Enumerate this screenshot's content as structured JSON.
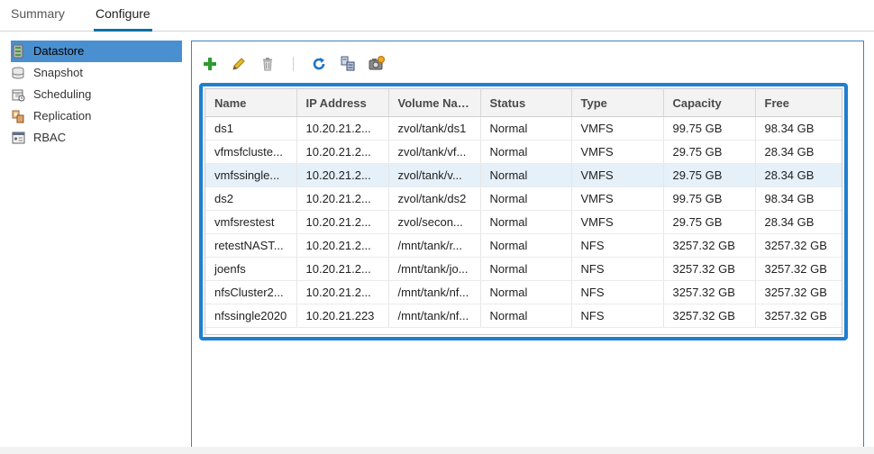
{
  "tabs": [
    {
      "label": "Summary",
      "active": false
    },
    {
      "label": "Configure",
      "active": true
    }
  ],
  "sidebar": {
    "items": [
      {
        "label": "Datastore",
        "icon": "datastore-icon",
        "active": true
      },
      {
        "label": "Snapshot",
        "icon": "snapshot-icon",
        "active": false
      },
      {
        "label": "Scheduling",
        "icon": "scheduling-icon",
        "active": false
      },
      {
        "label": "Replication",
        "icon": "replication-icon",
        "active": false
      },
      {
        "label": "RBAC",
        "icon": "rbac-icon",
        "active": false
      }
    ]
  },
  "toolbar": {
    "buttons": [
      "add-icon",
      "edit-icon",
      "delete-icon",
      "refresh-icon",
      "mount-icon",
      "snapshot-camera-icon"
    ]
  },
  "grid": {
    "columns": [
      "Name",
      "IP Address",
      "Volume Name...",
      "Status",
      "Type",
      "Capacity",
      "Free"
    ],
    "rows": [
      [
        "ds1",
        "10.20.21.2...",
        "zvol/tank/ds1",
        "Normal",
        "VMFS",
        "99.75 GB",
        "98.34 GB"
      ],
      [
        "vfmsfcluste...",
        "10.20.21.2...",
        "zvol/tank/vf...",
        "Normal",
        "VMFS",
        "29.75 GB",
        "28.34 GB"
      ],
      [
        "vmfssingle...",
        "10.20.21.2...",
        "zvol/tank/v...",
        "Normal",
        "VMFS",
        "29.75 GB",
        "28.34 GB"
      ],
      [
        "ds2",
        "10.20.21.2...",
        "zvol/tank/ds2",
        "Normal",
        "VMFS",
        "99.75 GB",
        "98.34 GB"
      ],
      [
        "vmfsrestest",
        "10.20.21.2...",
        "zvol/secon...",
        "Normal",
        "VMFS",
        "29.75 GB",
        "28.34 GB"
      ],
      [
        "retestNAST...",
        "10.20.21.2...",
        "/mnt/tank/r...",
        "Normal",
        "NFS",
        "3257.32 GB",
        "3257.32 GB"
      ],
      [
        "joenfs",
        "10.20.21.2...",
        "/mnt/tank/jo...",
        "Normal",
        "NFS",
        "3257.32 GB",
        "3257.32 GB"
      ],
      [
        "nfsCluster2...",
        "10.20.21.2...",
        "/mnt/tank/nf...",
        "Normal",
        "NFS",
        "3257.32 GB",
        "3257.32 GB"
      ],
      [
        "nfssingle2020",
        "10.20.21.223",
        "/mnt/tank/nf...",
        "Normal",
        "NFS",
        "3257.32 GB",
        "3257.32 GB"
      ]
    ],
    "selected_row": 2
  },
  "colors": {
    "accent": "#0072a3",
    "sidebar_active": "#4a8fcf",
    "grid_focus_border": "#1e7fd0",
    "selected_row": "#e5f0f9"
  }
}
